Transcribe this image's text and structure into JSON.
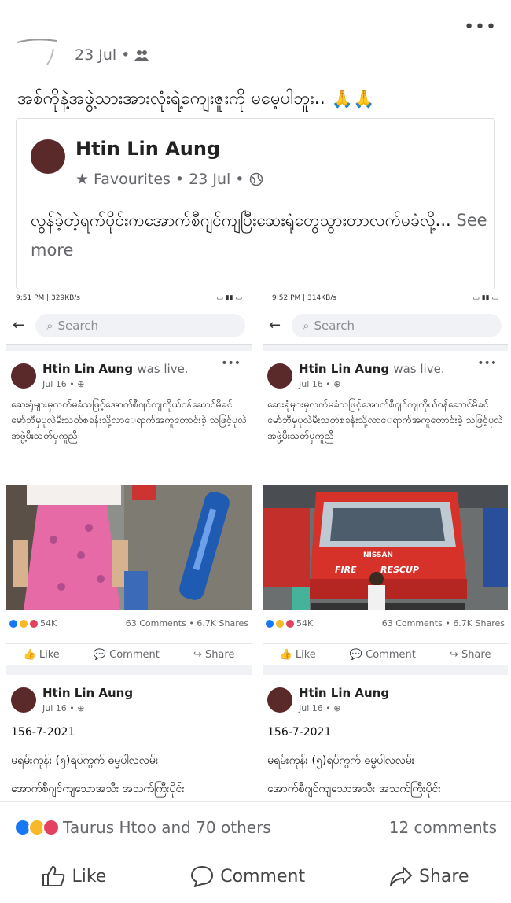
{
  "post": {
    "date": "23 Jul",
    "caption": "အစ်ကိုနဲ့အဖွဲ့သားအားလုံးရဲ့ကျေးဇူးကို မမေ့ပါဘူး.."
  },
  "shared": {
    "author": "Htin Lin Aung",
    "meta_fav": "Favourites",
    "meta_date": "23 Jul",
    "text": "လွန်ခဲ့တဲ့ရက်ပိုင်းကအောက်စီဂျင်ကျပြီးဆေးရုံတွေသွားတာလက်မခံလို့...",
    "see_more": "See more"
  },
  "left": {
    "status_time": "9:51 PM | 329KB/s",
    "search": "Search",
    "author": "Htin Lin Aung",
    "was_live": "was live.",
    "date": "Jul 16",
    "text": "ဆေးရုံများမှလက်မခံသဖြင့်အောက်စီဂျင်ကျကိုယ်ဝန်ဆောင်မိခင်မော်ဘီမှပုလဲမီးသတ်စခန်းသို့လာေရာက်အကူတောင်းခဲ့ သဖြင့်ပုလဲအဖွဲ့မီးသတ်မှကူညီ",
    "reactions": "54K",
    "comments": "63 Comments",
    "shares": "6.7K Shares",
    "like": "Like",
    "comment": "Comment",
    "share": "Share",
    "author2": "Htin Lin Aung",
    "date2": "Jul 16",
    "line1": "156-7-2021",
    "line2": "မရမ်းကုန်း (၅)ရပ်ကွက် ဓမ္မပါလလမ်း",
    "line3": "အောက်စီဂျင်ကျသောအသီး အသက်ကြီးပိုင်း"
  },
  "right": {
    "status_time": "9:52 PM | 314KB/s",
    "search": "Search",
    "author": "Htin Lin Aung",
    "was_live": "was live.",
    "date": "Jul 16",
    "text": "ဆေးရုံများမှလက်မခံသဖြင့်အောက်စီဂျင်ကျကိုယ်ဝန်ဆောင်မိခင်မော်ဘီမှပုလဲမီးသတ်စခန်းသို့လာေရာက်အကူတောင်းခဲ့ သဖြင့်ပုလဲအဖွဲ့မီးသတ်မှကူညီ",
    "reactions": "54K",
    "comments": "63 Comments",
    "shares": "6.7K Shares",
    "like": "Like",
    "comment": "Comment",
    "share": "Share",
    "truck_brand": "NISSAN",
    "truck_text1": "FIRE",
    "truck_text2": "RESCUP",
    "author2": "Htin Lin Aung",
    "date2": "Jul 16",
    "line1": "156-7-2021",
    "line2": "မရမ်းကုန်း (၅)ရပ်ကွက် ဓမ္မပါလလမ်း",
    "line3": "အောက်စီဂျင်ကျသောအသီး အသက်ကြီးပိုင်း"
  },
  "footer": {
    "reactors": "Taurus Htoo and 70 others",
    "comments": "12 comments",
    "like": "Like",
    "comment": "Comment",
    "share": "Share"
  }
}
